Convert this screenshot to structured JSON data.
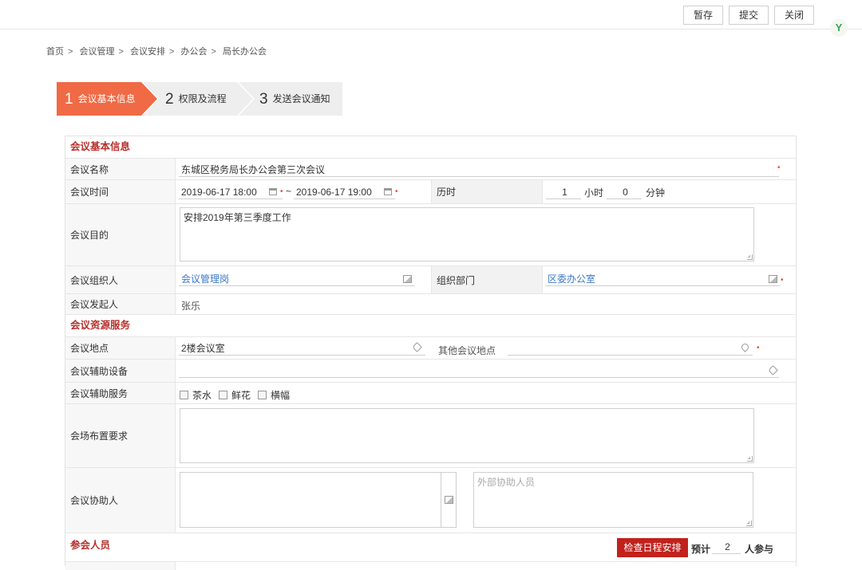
{
  "toolbar": {
    "save": "暂存",
    "submit": "提交",
    "close": "关闭"
  },
  "brand": {
    "glyph": "Y",
    "color": "#3aa655"
  },
  "breadcrumb": [
    "首页",
    "会议管理",
    "会议安排",
    "办公会",
    "局长办公会"
  ],
  "breadcrumb_sep": ">",
  "steps": [
    {
      "num": "1",
      "label": "会议基本信息",
      "active": true
    },
    {
      "num": "2",
      "label": "权限及流程",
      "active": false
    },
    {
      "num": "3",
      "label": "发送会议通知",
      "active": false
    }
  ],
  "colors": {
    "accent": "#f06a45",
    "section_title": "#b7312c",
    "link": "#3b77c8",
    "button_red": "#c2211c"
  },
  "section_basic": {
    "title": "会议基本信息",
    "name_label": "会议名称",
    "name_value": "东城区税务局长办公会第三次会议",
    "time_label": "会议时间",
    "start": "2019-06-17 18:00",
    "tilde": "~",
    "end": "2019-06-17 19:00",
    "duration_label": "历时",
    "hours": "1",
    "hours_unit": "小时",
    "minutes": "0",
    "minutes_unit": "分钟",
    "purpose_label": "会议目的",
    "purpose_value": "安排2019年第三季度工作",
    "organizer_label": "会议组织人",
    "organizer_value": "会议管理岗",
    "dept_label": "组织部门",
    "dept_value": "区委办公室",
    "initiator_label": "会议发起人",
    "initiator_value": "张乐"
  },
  "section_resource": {
    "title": "会议资源服务",
    "location_label": "会议地点",
    "location_value": "2楼会议室",
    "other_location_label": "其他会议地点",
    "equipment_label": "会议辅助设备",
    "service_label": "会议辅助服务",
    "services": [
      "茶水",
      "鲜花",
      "横幅"
    ],
    "layout_label": "会场布置要求",
    "assistant_label": "会议协助人",
    "external_placeholder": "外部协助人员"
  },
  "section_participants": {
    "title": "参会人员",
    "check_schedule": "检查日程安排",
    "expected_label": "预计",
    "expected_count": "2",
    "people_suffix": "人参与"
  }
}
